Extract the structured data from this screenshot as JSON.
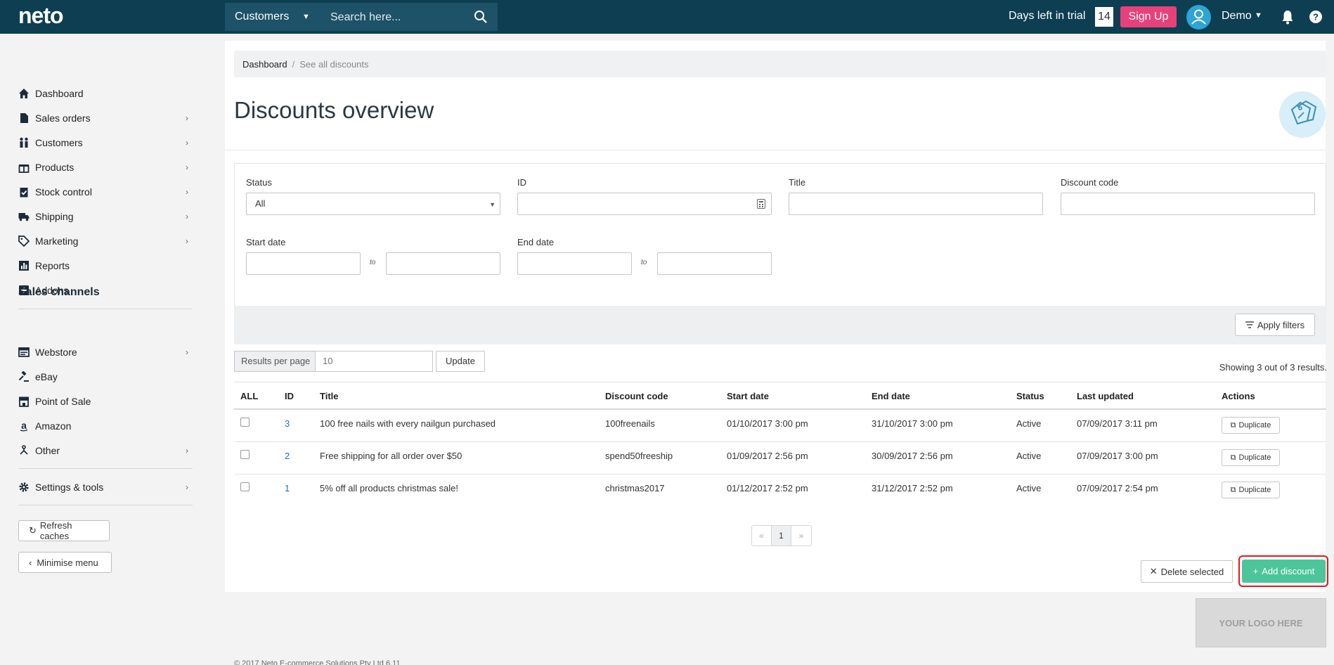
{
  "topbar": {
    "logo": "neto",
    "search_scope": "Customers",
    "search_placeholder": "Search here...",
    "trial_label": "Days left in trial",
    "trial_days": "14",
    "signup_label": "Sign Up",
    "user_name": "Demo",
    "colors": {
      "bar": "#0e3e52",
      "signup": "#e8417a",
      "avatar": "#2fa4d6"
    }
  },
  "sidebar": {
    "items": [
      {
        "label": "Dashboard",
        "icon": "home-icon",
        "chevron": false
      },
      {
        "label": "Sales orders",
        "icon": "document-icon",
        "chevron": true
      },
      {
        "label": "Customers",
        "icon": "people-icon",
        "chevron": true
      },
      {
        "label": "Products",
        "icon": "gift-icon",
        "chevron": true
      },
      {
        "label": "Stock control",
        "icon": "clipboard-check-icon",
        "chevron": true
      },
      {
        "label": "Shipping",
        "icon": "truck-icon",
        "chevron": true
      },
      {
        "label": "Marketing",
        "icon": "tag-icon",
        "chevron": true
      },
      {
        "label": "Reports",
        "icon": "bar-chart-icon",
        "chevron": false
      },
      {
        "label": "Addons",
        "icon": "plus-square-icon",
        "chevron": false
      }
    ],
    "channels_heading": "Sales channels",
    "channels": [
      {
        "label": "Webstore",
        "icon": "browser-icon",
        "chevron": true
      },
      {
        "label": "eBay",
        "icon": "gavel-icon",
        "chevron": false
      },
      {
        "label": "Point of Sale",
        "icon": "store-icon",
        "chevron": false
      },
      {
        "label": "Amazon",
        "icon": "amazon-icon",
        "chevron": false
      },
      {
        "label": "Other",
        "icon": "branch-icon",
        "chevron": true
      }
    ],
    "settings": {
      "label": "Settings & tools",
      "icon": "gear-icon"
    },
    "refresh_label": "Refresh caches",
    "minimise_label": "Minimise menu"
  },
  "breadcrumb": {
    "root": "Dashboard",
    "current": "See all discounts"
  },
  "page_title": "Discounts overview",
  "filters": {
    "status_label": "Status",
    "status_value": "All",
    "id_label": "ID",
    "title_label": "Title",
    "code_label": "Discount code",
    "start_label": "Start date",
    "end_label": "End date",
    "to_label": "to",
    "apply_label": "Apply filters"
  },
  "pagination_bar": {
    "rpp_label": "Results per page",
    "rpp_value": "10",
    "update_label": "Update",
    "showing": "Showing 3 out of 3 results."
  },
  "table": {
    "headers": [
      "ALL",
      "ID",
      "Title",
      "Discount code",
      "Start date",
      "End date",
      "Status",
      "Last updated",
      "Actions"
    ],
    "rows": [
      {
        "id": "3",
        "title": "100 free nails with every nailgun purchased",
        "code": "100freenails",
        "start": "01/10/2017 3:00 pm",
        "end": "31/10/2017 3:00 pm",
        "status": "Active",
        "updated": "07/09/2017 3:11 pm",
        "action": "Duplicate"
      },
      {
        "id": "2",
        "title": "Free shipping for all order over $50",
        "code": "spend50freeship",
        "start": "01/09/2017 2:56 pm",
        "end": "30/09/2017 2:56 pm",
        "status": "Active",
        "updated": "07/09/2017 3:00 pm",
        "action": "Duplicate"
      },
      {
        "id": "1",
        "title": "5% off all products christmas sale!",
        "code": "christmas2017",
        "start": "01/12/2017 2:52 pm",
        "end": "31/12/2017 2:52 pm",
        "status": "Active",
        "updated": "07/09/2017 2:54 pm",
        "action": "Duplicate"
      }
    ]
  },
  "pager": {
    "prev": "«",
    "current": "1",
    "next": "»"
  },
  "actions": {
    "delete_label": "Delete selected",
    "add_label": "Add discount",
    "colors": {
      "add": "#4cc59a",
      "highlight": "#e8141f"
    }
  },
  "logo_placeholder": "YOUR LOGO HERE",
  "footer": "© 2017 Neto E-commerce Solutions Pty Ltd  6.11"
}
